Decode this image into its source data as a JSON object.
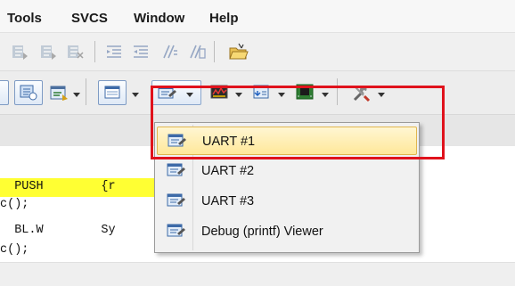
{
  "menu": {
    "tools": "Tools",
    "svcs": "SVCS",
    "window": "Window",
    "help": "Help"
  },
  "editor": {
    "lines": [
      {
        "name": "code-line-push",
        "text": "  PUSH        {r",
        "highlighted": true
      },
      {
        "name": "code-line-2",
        "text": "c();"
      },
      {
        "name": "code-line-blw",
        "text": "  BL.W        Sy"
      },
      {
        "name": "code-line-4",
        "text": "c();"
      }
    ]
  },
  "dropdown": {
    "items": [
      {
        "label": "UART #1",
        "selected": true
      },
      {
        "label": "UART #2"
      },
      {
        "label": "UART #3"
      },
      {
        "label": "Debug (printf) Viewer"
      }
    ]
  },
  "colors": {
    "highlight": "#ffff33",
    "annotation": "#e0121c",
    "selection": "#ffe89a"
  }
}
